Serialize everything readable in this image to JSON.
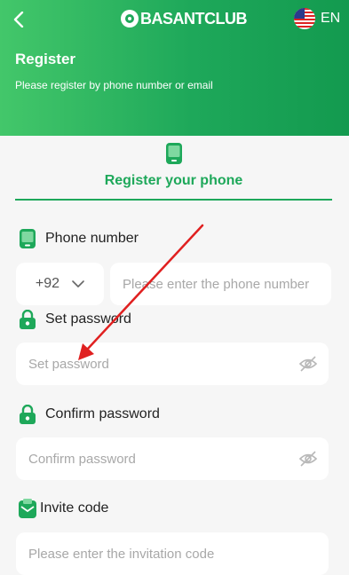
{
  "header": {
    "back_icon": "chevron-left-icon",
    "logo_text": "BASANTCLUB",
    "language": "EN",
    "flag_icon": "us-flag-icon",
    "title": "Register",
    "subtitle": "Please register by phone number or email"
  },
  "tab": {
    "label": "Register your phone",
    "icon": "phone-icon"
  },
  "form": {
    "phone_label": "Phone number",
    "country_code": "+92",
    "phone_placeholder": "Please enter the phone number",
    "password_label": "Set password",
    "password_placeholder": "Set password",
    "confirm_label": "Confirm password",
    "confirm_placeholder": "Confirm password",
    "invite_label": "Invite code",
    "invite_placeholder": "Please enter the invitation code"
  },
  "colors": {
    "accent": "#1ea85a",
    "annotation_arrow": "#e02020"
  }
}
